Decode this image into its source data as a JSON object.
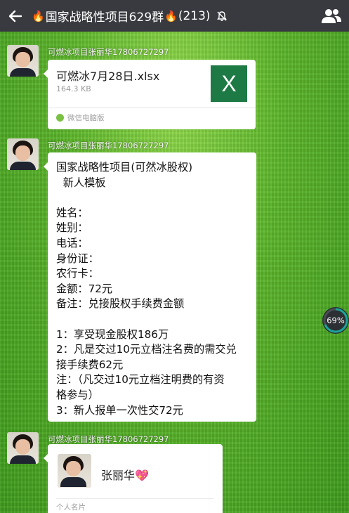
{
  "header": {
    "title": "国家战略性项目629群",
    "member_count": "(213)",
    "fire_glyph": "🔥"
  },
  "messages": [
    {
      "sender": "可燃冰项目张丽华17806727297",
      "type": "file",
      "file_name": "可燃冰7月28日.xlsx",
      "file_size": "164.3 KB",
      "file_icon_letter": "X",
      "source": "微信电脑版"
    },
    {
      "sender": "可燃冰项目张丽华17806727297",
      "type": "text",
      "lines": [
        "国家战略性项目(可然冰股权)",
        "  新人模板",
        "",
        "姓名：",
        "姓别：",
        "电话：",
        "身份证：",
        "农行卡：",
        "金额：72元",
        "备注：兑接股权手续费金额",
        "",
        "1：享受现金股权186万",
        "2：凡是交过10元立档注名费的需交兑",
        "接手续费62元",
        "注：（凡交过10元立档注明费的有资",
        "格参与）",
        "3：新人报单一次性交72元"
      ]
    },
    {
      "sender": "可燃冰项目张丽华17806727297",
      "type": "card",
      "card_name": "张丽华💖",
      "card_label": "个人名片"
    }
  ],
  "overlay": {
    "progress_percent": 69,
    "progress_label": "69%"
  },
  "colors": {
    "topbar": "#393a3f",
    "excel_green": "#1d7a45",
    "progress_accent": "#1aa59a"
  },
  "icons": {
    "back": "arrow-left-icon",
    "mute": "bell-muted-icon",
    "members": "people-icon"
  }
}
